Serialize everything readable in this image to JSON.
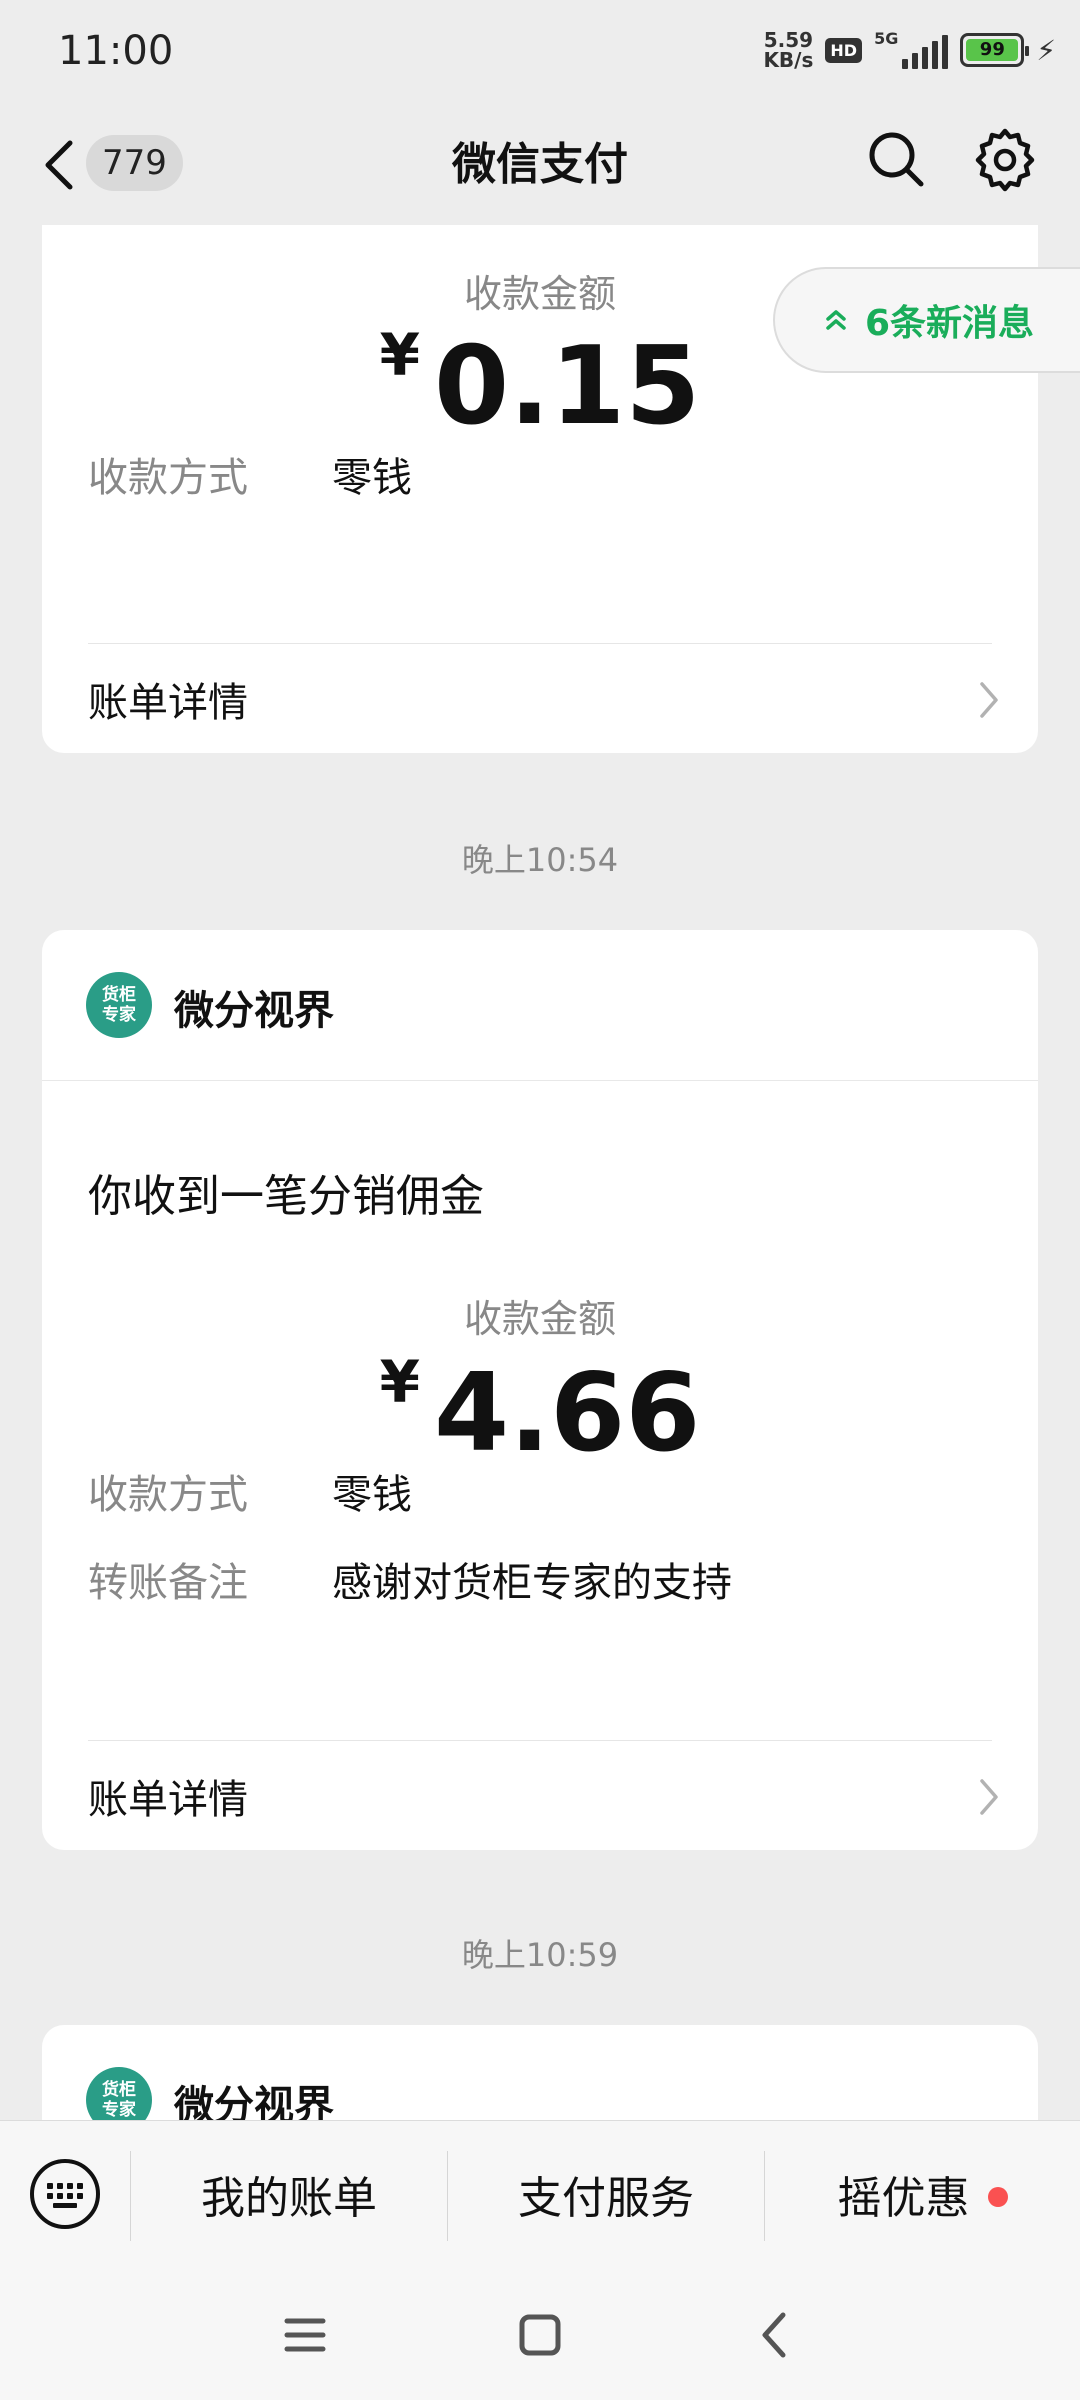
{
  "status_bar": {
    "time": "11:00",
    "net_speed_value": "5.59",
    "net_speed_unit": "KB/s",
    "hd": "HD",
    "network": "5G",
    "battery": "99"
  },
  "header": {
    "unread_count": "779",
    "title": "微信支付"
  },
  "new_messages": {
    "label": "6条新消息"
  },
  "messages": [
    {
      "amount_label": "收款金额",
      "currency": "¥",
      "amount": "0.15",
      "method_label": "收款方式",
      "method_value": "零钱",
      "detail_label": "账单详情"
    },
    {
      "time": "晚上10:54",
      "merchant_logo_text": "货柜专家",
      "merchant_name": "微分视界",
      "title": "你收到一笔分销佣金",
      "amount_label": "收款金额",
      "currency": "¥",
      "amount": "4.66",
      "method_label": "收款方式",
      "method_value": "零钱",
      "remark_label": "转账备注",
      "remark_value": "感谢对货柜专家的支持",
      "detail_label": "账单详情"
    },
    {
      "time": "晚上10:59",
      "merchant_logo_text": "货柜专家",
      "merchant_name": "微分视界"
    }
  ],
  "bottom_menu": {
    "items": [
      "我的账单",
      "支付服务",
      "摇优惠"
    ]
  },
  "colors": {
    "accent_green": "#1aad5a",
    "logo_teal": "#2a9d87",
    "red_dot": "#fa5151",
    "background": "#ededed"
  },
  "icons": [
    "back-icon",
    "search-icon",
    "gear-icon",
    "chevron-right-icon",
    "double-chevron-up-icon",
    "keyboard-icon",
    "menu-icon",
    "home-square-icon",
    "back-triangle-icon"
  ]
}
